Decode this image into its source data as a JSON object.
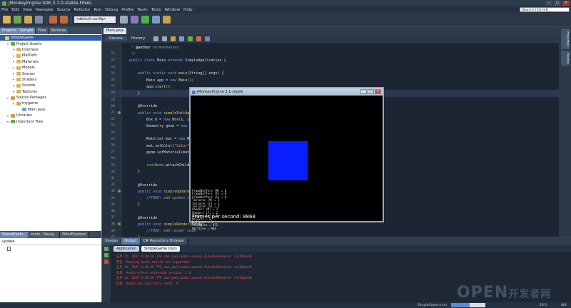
{
  "window": {
    "title": "jMonkeyEngine SDK 3.1.0-stable-FINAL"
  },
  "menu": [
    "File",
    "Edit",
    "View",
    "Navigate",
    "Source",
    "Refactor",
    "Run",
    "Debug",
    "Profile",
    "Team",
    "Tools",
    "Window",
    "Help"
  ],
  "search": {
    "placeholder": "Search (Ctrl+I)"
  },
  "toolbar": {
    "config": "<default config>"
  },
  "left": {
    "tabs": [
      "Projects - Sample",
      "Files",
      "Services"
    ],
    "tree": [
      {
        "label": "SimpleGame",
        "level": 0,
        "selected": true,
        "icon": "project-icon",
        "color": "#e8c46a"
      },
      {
        "label": "Project Assets",
        "level": 1,
        "icon": "assets-folder-icon",
        "color": "#6aa84f"
      },
      {
        "label": "Interface",
        "level": 2,
        "icon": "folder-icon",
        "color": "#d9b25a"
      },
      {
        "label": "MatDefs",
        "level": 2,
        "icon": "folder-icon",
        "color": "#d9b25a"
      },
      {
        "label": "Materials",
        "level": 2,
        "icon": "folder-icon",
        "color": "#d9b25a"
      },
      {
        "label": "Models",
        "level": 2,
        "icon": "folder-icon",
        "color": "#d9b25a"
      },
      {
        "label": "Scenes",
        "level": 2,
        "icon": "folder-icon",
        "color": "#d9b25a"
      },
      {
        "label": "Shaders",
        "level": 2,
        "icon": "folder-icon",
        "color": "#d9b25a"
      },
      {
        "label": "Sounds",
        "level": 2,
        "icon": "folder-icon",
        "color": "#d9b25a"
      },
      {
        "label": "Textures",
        "level": 2,
        "icon": "folder-icon",
        "color": "#d9b25a"
      },
      {
        "label": "Source Packages",
        "level": 1,
        "icon": "source-packages-icon",
        "color": "#c9a04a"
      },
      {
        "label": "mygame",
        "level": 2,
        "icon": "package-icon",
        "color": "#d0a85a"
      },
      {
        "label": "Main.java",
        "level": 3,
        "icon": "java-file-icon",
        "color": "#7aa0d0"
      },
      {
        "label": "Libraries",
        "level": 1,
        "icon": "libraries-icon",
        "color": "#c9a04a"
      },
      {
        "label": "Important Files",
        "level": 1,
        "icon": "important-files-icon",
        "color": "#6aa84f"
      }
    ],
    "bottom_tabs": [
      "SceneExplo...",
      "main - Navig...",
      "FilterExplorer"
    ],
    "nav_value": "update"
  },
  "editor": {
    "file_tab": "Main.java",
    "view_tabs": [
      "Source",
      "History"
    ],
    "lines": [
      {
        "n": "",
        "html": "<span class=\"cm\">   * </span><span class=\"tag\">@author</span><span class=\"cm\"> normenhansen</span>"
      },
      {
        "n": "12",
        "html": "<span class=\"cm\">   */</span>"
      },
      {
        "n": "13",
        "html": "<span class=\"kw\">  public class</span> Main <span class=\"kw\">extends</span> SimpleApplication {"
      },
      {
        "n": "14",
        "html": ""
      },
      {
        "n": "15",
        "html": "<span class=\"kw\">      public static void</span> <span class=\"fn\">main</span>(String[] args) {"
      },
      {
        "n": "16",
        "html": "          Main app = <span class=\"kw\">new</span> Main();"
      },
      {
        "n": "17",
        "html": "          app.start();"
      },
      {
        "n": "18",
        "html": "      }",
        "hl": true
      },
      {
        "n": "19",
        "html": ""
      },
      {
        "n": "20",
        "html": "      @Override"
      },
      {
        "n": "21",
        "html": "<span class=\"kw\">      public void</span> <span class=\"fn\">simpleInitApp</span>() {"
      },
      {
        "n": "22",
        "html": "          Box b = <span class=\"kw\">new</span> Box(1, 1, 1);"
      },
      {
        "n": "23",
        "html": "          Geometry geom = <span class=\"kw\">new</span> Geom"
      },
      {
        "n": "24",
        "html": ""
      },
      {
        "n": "25",
        "html": "          Material mat = <span class=\"kw\">new</span> Material("
      },
      {
        "n": "26",
        "html": "          mat.setColor(<span class=\"str\">\"Color\"</span>, ColorR"
      },
      {
        "n": "27",
        "html": "          geom.setMaterial(mat);"
      },
      {
        "n": "28",
        "html": ""
      },
      {
        "n": "29",
        "html": "<span class=\"green\">          rootNode</span>.attachChild(geom);"
      },
      {
        "n": "30",
        "html": "      }"
      },
      {
        "n": "31",
        "html": ""
      },
      {
        "n": "32",
        "html": "      @Override"
      },
      {
        "n": "33",
        "html": "<span class=\"kw\">      public void</span> <span class=\"fn\">simpleUpdate</span>(<span class=\"kw\">float</span>"
      },
      {
        "n": "34",
        "html": "<span class=\"cm\">          //TODO: add update code</span>"
      },
      {
        "n": "35",
        "html": "      }"
      },
      {
        "n": "36",
        "html": ""
      },
      {
        "n": "37",
        "html": "      @Override"
      },
      {
        "n": "38",
        "html": "<span class=\"kw\">      public void</span> <span class=\"fn\">simpleRender</span>(Rende"
      },
      {
        "n": "39",
        "html": "<span class=\"cm\">          //TODO: add render code</span>"
      },
      {
        "n": "40",
        "html": "      }"
      },
      {
        "n": "41",
        "html": "  }"
      }
    ]
  },
  "right_strip": [
    "Properties",
    "Palette"
  ],
  "jme": {
    "title": "jMonkeyEngine 3.1-stable",
    "stats": [
      "FrameBuffers (M) = 0",
      "FrameBuffers (F) = 0",
      "FrameBuffers (S) = 0",
      "Textures (M) = 2",
      "Textures (F) = 2",
      "Textures (S) = 2",
      "Shaders (M) = 2",
      "Shaders (F) = 2",
      "Shaders (S) = 2",
      "Objects = 4",
      "Uniforms = 3",
      "Triangles = 472",
      "Vertices = 944"
    ],
    "fps_label": "Frames per second: 8868"
  },
  "output": {
    "tabs": [
      "Usages",
      "Output",
      "C# Repository Browser"
    ],
    "subtabs": [
      "Application",
      "SimpleGame (run)"
    ],
    "log": [
      "五月 11, 2017 4:18:39 下午 com.jme3.audio.openal.ALAudioRenderer initOpenAL",
      "警告: Pausing audio device not supported.",
      "五月 11, 2017 4:18:39 下午 com.jme3.audio.openal.ALAudioRenderer initOpenAL",
      "信息: Audio effect extension version: 1.0",
      "五月 11, 2017 4:18:39 下午 com.jme3.audio.openal.ALAudioRenderer initOpenAL",
      "信息: Audio max auxiliary sends: 4"
    ]
  },
  "status": {
    "run_label": "SimpleGame (run)",
    "progress_label": "running...",
    "progress": 0.55,
    "position": "20:5",
    "mode": "INS"
  },
  "watermark": {
    "text": "OPEN",
    "cn": "开发者网"
  },
  "colors": {
    "accent": "#2f5ea8",
    "jme_box": "#0a1fff",
    "error_text": "#ff4a4a"
  }
}
